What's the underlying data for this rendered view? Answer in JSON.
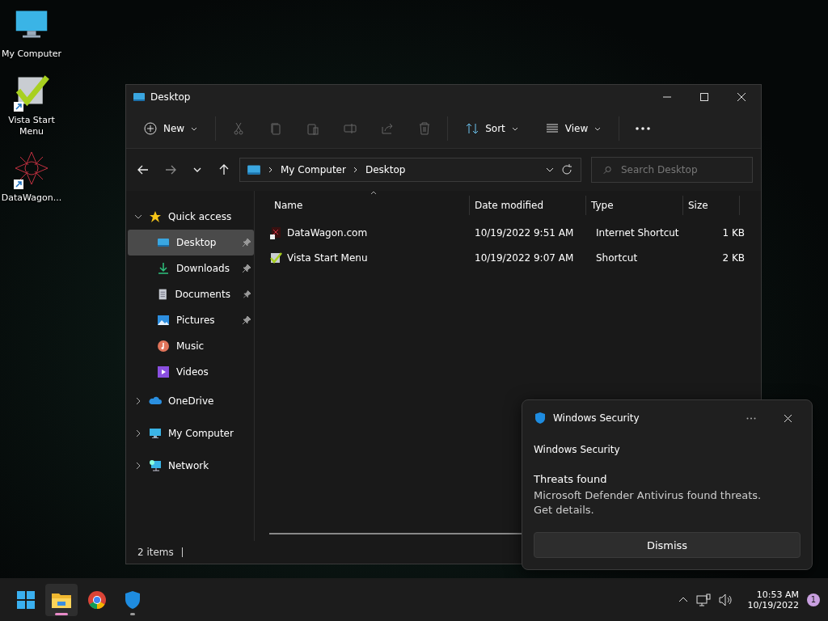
{
  "desktop_icons": [
    {
      "label": "My Computer",
      "kind": "computer",
      "shortcut": false
    },
    {
      "label": "Vista Start Menu",
      "kind": "check",
      "shortcut": true
    },
    {
      "label": "DataWagon...",
      "kind": "star",
      "shortcut": true
    }
  ],
  "window": {
    "title": "Desktop",
    "toolbar": {
      "new": "New",
      "sort": "Sort",
      "view": "View"
    },
    "address": {
      "crumbs": [
        "My Computer",
        "Desktop"
      ],
      "search_placeholder": "Search Desktop"
    },
    "sidebar": [
      {
        "label": "Quick access",
        "kind": "star",
        "expanded": true,
        "children": [
          {
            "label": "Desktop",
            "kind": "desktop",
            "selected": true,
            "pinned": true
          },
          {
            "label": "Downloads",
            "kind": "download",
            "selected": false,
            "pinned": true
          },
          {
            "label": "Documents",
            "kind": "document",
            "selected": false,
            "pinned": true
          },
          {
            "label": "Pictures",
            "kind": "picture",
            "selected": false,
            "pinned": true
          },
          {
            "label": "Music",
            "kind": "music",
            "selected": false,
            "pinned": false
          },
          {
            "label": "Videos",
            "kind": "video",
            "selected": false,
            "pinned": false
          }
        ]
      },
      {
        "label": "OneDrive",
        "kind": "cloud",
        "expanded": false
      },
      {
        "label": "My Computer",
        "kind": "computer",
        "expanded": false
      },
      {
        "label": "Network",
        "kind": "network",
        "expanded": false
      }
    ],
    "columns": [
      "Name",
      "Date modified",
      "Type",
      "Size"
    ],
    "rows": [
      {
        "name": "DataWagon.com",
        "kind": "web",
        "date": "10/19/2022 9:51 AM",
        "type": "Internet Shortcut",
        "size": "1 KB"
      },
      {
        "name": "Vista Start Menu",
        "kind": "check",
        "date": "10/19/2022 9:07 AM",
        "type": "Shortcut",
        "size": "2 KB"
      }
    ],
    "status_bar": "2 items"
  },
  "toast": {
    "app": "Windows Security",
    "source": "Windows Security",
    "heading": "Threats found",
    "body": "Microsoft Defender Antivirus found threats. Get details.",
    "button": "Dismiss"
  },
  "taskbar": {
    "apps": [
      {
        "kind": "start",
        "active": false,
        "running": false
      },
      {
        "kind": "folder",
        "active": true,
        "running": true
      },
      {
        "kind": "browser",
        "active": false,
        "running": false
      },
      {
        "kind": "shield",
        "active": false,
        "running": true
      }
    ],
    "time": "10:53 AM",
    "date": "10/19/2022",
    "notifications": "1"
  }
}
